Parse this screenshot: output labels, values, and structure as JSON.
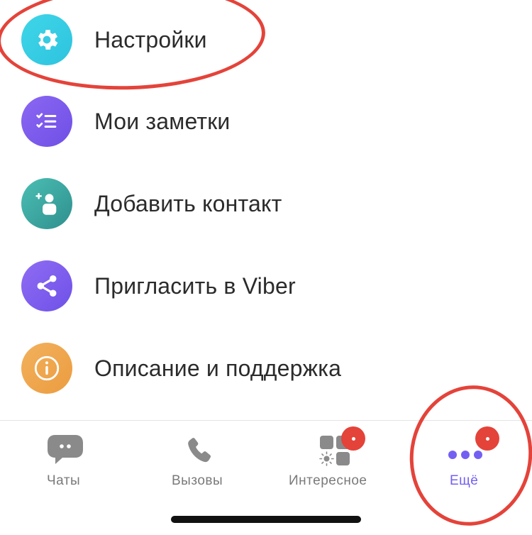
{
  "menu": {
    "items": [
      {
        "label": "Настройки",
        "icon": "gear-icon",
        "color": "#3fd6e8"
      },
      {
        "label": "Мои заметки",
        "icon": "checklist-icon",
        "color": "#7a5bf0"
      },
      {
        "label": "Добавить контакт",
        "icon": "add-contact-icon",
        "color": "#3aa6a0"
      },
      {
        "label": "Пригласить в Viber",
        "icon": "share-icon",
        "color": "#7f60f0"
      },
      {
        "label": "Описание и поддержка",
        "icon": "info-icon",
        "color": "#f0a84e"
      }
    ]
  },
  "tabbar": {
    "tabs": [
      {
        "label": "Чаты",
        "icon": "chat-bubble-icon",
        "active": false
      },
      {
        "label": "Вызовы",
        "icon": "phone-icon",
        "active": false
      },
      {
        "label": "Интересное",
        "icon": "explore-grid-icon",
        "active": false,
        "badge": true
      },
      {
        "label": "Ещё",
        "icon": "more-dots-icon",
        "active": true,
        "badge": true
      }
    ]
  },
  "colors": {
    "accent": "#7360f2",
    "annotation": "#e4433a",
    "inactive_tab": "#7a7a7a",
    "text": "#2b2b2b"
  }
}
